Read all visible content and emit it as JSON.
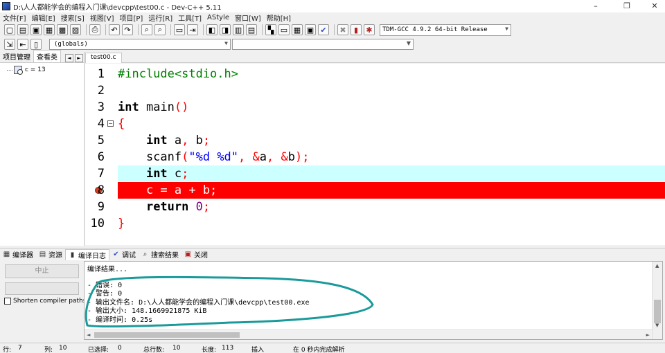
{
  "window": {
    "title": "D:\\人人都能学会的编程入门课\\devcpp\\test00.c - Dev-C++ 5.11",
    "controls": [
      "–",
      "❐",
      "✕"
    ]
  },
  "menu": [
    "文件[F]",
    "编辑[E]",
    "搜索[S]",
    "视图[V]",
    "项目[P]",
    "运行[R]",
    "工具[T]",
    "AStyle",
    "窗口[W]",
    "帮助[H]"
  ],
  "toolbar": {
    "compiler": "TDM-GCC 4.9.2 64-bit Release"
  },
  "toolbar2": {
    "scope": "(globals)"
  },
  "left_panel": {
    "tabs": [
      "项目管理",
      "查看类"
    ],
    "nav": [
      "◄",
      "►"
    ],
    "tree_item": "c = 13"
  },
  "editor": {
    "file_tab": "test00.c",
    "lines": [
      {
        "num": "1",
        "text": "#include<stdio.h>"
      },
      {
        "num": "2",
        "text": ""
      },
      {
        "num": "3",
        "text": "int main()"
      },
      {
        "num": "4",
        "text": "{"
      },
      {
        "num": "5",
        "text": "    int a, b;"
      },
      {
        "num": "6",
        "text": "    scanf(\"%d %d\", &a, &b);"
      },
      {
        "num": "7",
        "text": "    int c;"
      },
      {
        "num": "8",
        "text": "    c = a + b;"
      },
      {
        "num": "9",
        "text": "    return 0;"
      },
      {
        "num": "10",
        "text": "}"
      }
    ]
  },
  "bottom": {
    "tabs": [
      "编译器",
      "资源",
      "编译日志",
      "调试",
      "搜索结果",
      "关闭"
    ],
    "abort_button": "中止",
    "shorten_label": "Shorten compiler paths",
    "log": [
      "编译结果...",
      "- 错误: 0",
      "- 警告: 0",
      "- 输出文件名: D:\\人人都能学会的编程入门课\\devcpp\\test00.exe",
      "- 输出大小: 148.1669921875 KiB",
      "- 编译时间: 0.25s"
    ]
  },
  "status": {
    "row_label": "行:",
    "row_value": "7",
    "col_label": "列:",
    "col_value": "10",
    "sel_label": "已选择:",
    "sel_value": "0",
    "lines_label": "总行数:",
    "lines_value": "10",
    "len_label": "长度:",
    "len_value": "113",
    "mode": "插入",
    "parse": "在 0 秒内完成解析"
  },
  "colors": {
    "current_line": "#ccffff",
    "breakpoint_line": "#ff0000",
    "annotation_circle": "#1a9a9a"
  }
}
